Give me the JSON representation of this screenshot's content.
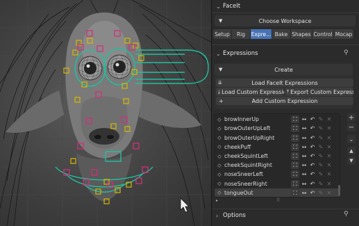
{
  "panel": {
    "faceit_header": "FaceIt",
    "workspace_button": "Choose Workspace",
    "tabs": [
      {
        "label": "Setup",
        "active": false
      },
      {
        "label": "Rig",
        "active": false
      },
      {
        "label": "Expre...",
        "active": true
      },
      {
        "label": "Bake",
        "active": false
      },
      {
        "label": "Shapes",
        "active": false
      },
      {
        "label": "Control",
        "active": false
      },
      {
        "label": "Mocap",
        "active": false
      }
    ],
    "expressions_header": "Expressions",
    "create_button": "Create",
    "load_faceit_expressions": "Load FaceIt Expressions",
    "load_custom_expression": "Load Custom Expressio...",
    "export_custom_expression": "Export Custom Expressi...",
    "add_custom_expression": "Add Custom Expression",
    "options_header": "Options",
    "expression_list": [
      {
        "name": "browInnerUp",
        "selected": false
      },
      {
        "name": "browOuterUpLeft",
        "selected": false
      },
      {
        "name": "browOuterUpRight",
        "selected": false
      },
      {
        "name": "cheekPuff",
        "selected": false
      },
      {
        "name": "cheekSquintLeft",
        "selected": false
      },
      {
        "name": "cheekSquintRight",
        "selected": false
      },
      {
        "name": "noseSneerLeft",
        "selected": false
      },
      {
        "name": "noseSneerRight",
        "selected": false
      },
      {
        "name": "tongueOut",
        "selected": true
      }
    ]
  },
  "icons": {
    "row_icons": [
      "bone-icon",
      "mirror-arrows-icon",
      "reset-icon",
      "pencil-icon",
      "remove-icon"
    ],
    "side_buttons": [
      "add-icon",
      "remove-icon",
      "chevron-down-icon",
      "move-up-icon",
      "move-down-icon"
    ],
    "pin": "pin-icon"
  },
  "colors": {
    "accent": "#4772b3",
    "control_teal": "#20c0a0",
    "locator_yellow": "#d6b800",
    "locator_magenta": "#d0307a"
  }
}
